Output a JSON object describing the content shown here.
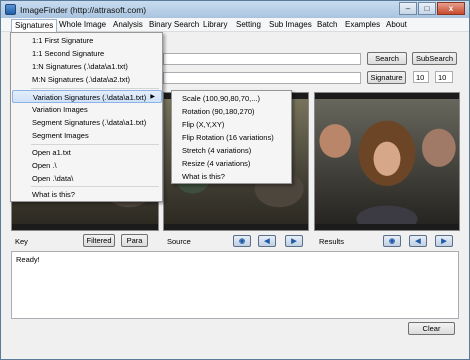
{
  "window": {
    "title": "ImageFinder (http://attrasoft.com)"
  },
  "titlebar_buttons": {
    "minimize": "–",
    "maximize": "□",
    "close": "x"
  },
  "menubar": [
    "Signatures",
    "Whole Image",
    "Analysis",
    "Binary Search",
    "Library",
    "Setting",
    "Sub Images",
    "Batch",
    "Examples",
    "About"
  ],
  "toolbar": {
    "search_label": "Search",
    "subsearch_label": "SubSearch",
    "signature_label": "Signature",
    "num1": "10",
    "num2": "10"
  },
  "signatures_menu": {
    "items": [
      "1:1 First Signature",
      "1:1 Second Signature",
      "1:N Signatures (.\\data\\a1.txt)",
      "M:N Signatures (.\\data\\a2.txt)",
      "Variation Signatures (.\\data\\a1.txt)",
      "Variation Images",
      "Segment Signatures (.\\data\\a1.txt)",
      "Segment Images",
      "Open a1.txt",
      "Open .\\",
      "Open .\\data\\",
      "What is this?"
    ]
  },
  "variation_submenu": {
    "items": [
      "Scale  (100,90,80,70,...)",
      "Rotation (90,180,270)",
      "Flip (X,Y,XY)",
      "Flip Rotation (16 variations)",
      "Stretch (4 variations)",
      "Resize (4 variations)",
      "What is this?"
    ]
  },
  "controls": {
    "key_label": "Key",
    "filtered_label": "Filtered",
    "para_label": "Para",
    "source_label": "Source",
    "results_label": "Results"
  },
  "nav_icons": {
    "home": "home-icon",
    "prev": "back-arrow-icon",
    "next": "forward-arrow-icon"
  },
  "log": {
    "text": "Ready!"
  },
  "clear_label": "Clear"
}
